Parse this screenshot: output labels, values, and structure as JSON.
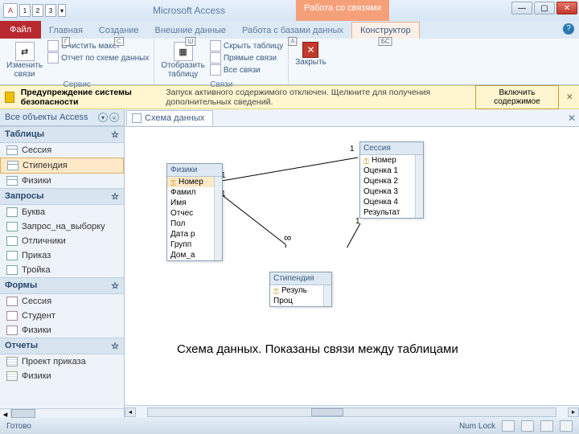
{
  "title": "Microsoft Access",
  "context_tab": "Работа со связями",
  "tabs": {
    "file": "Файл",
    "list": [
      {
        "label": "Главная",
        "key": "Г"
      },
      {
        "label": "Создание",
        "key": "С"
      },
      {
        "label": "Внешние данные",
        "key": "Ш"
      },
      {
        "label": "Работа с базами данных",
        "key": "А"
      },
      {
        "label": "Конструктор",
        "key": "БС"
      }
    ]
  },
  "ribbon": {
    "edit_rel_l1": "Изменить",
    "edit_rel_l2": "связи",
    "clear_layout": "Очистить макет",
    "rel_report": "Отчет по схеме данных",
    "g1": "Сервис",
    "show_tbl_l1": "Отобразить",
    "show_tbl_l2": "таблицу",
    "hide_tbl": "Скрыть таблицу",
    "direct": "Прямые связи",
    "all": "Все связи",
    "g2": "Связи",
    "close": "Закрыть"
  },
  "security": {
    "title": "Предупреждение системы безопасности",
    "msg": "Запуск активного содержимого отключен. Щелкните для получения дополнительных сведений.",
    "btn": "Включить содержимое"
  },
  "nav": {
    "header": "Все объекты Access",
    "sections": {
      "tables": "Таблицы",
      "queries": "Запросы",
      "forms": "Формы",
      "reports": "Отчеты"
    },
    "tables": [
      "Сессия",
      "Стипендия",
      "Физики"
    ],
    "queries": [
      "Буква",
      "Запрос_на_выборку",
      "Отличники",
      "Приказ",
      "Тройка"
    ],
    "forms": [
      "Сессия",
      "Студент",
      "Физики"
    ],
    "reports": [
      "Проект приказа",
      "Физики"
    ]
  },
  "doc_tab": "Схема данных",
  "tables_canvas": {
    "fiziki": {
      "title": "Физики",
      "fields": [
        "Номер",
        "Фамил",
        "Имя",
        "Отчес",
        "Пол",
        "Дата р",
        "Групп",
        "Дом_а"
      ]
    },
    "sessia": {
      "title": "Сессия",
      "fields": [
        "Номер",
        "Оценка 1",
        "Оценка 2",
        "Оценка 3",
        "Оценка 4",
        "Результат"
      ]
    },
    "stipendia": {
      "title": "Стипендия",
      "fields": [
        "Резуль",
        "Проц"
      ]
    }
  },
  "rel_labels": {
    "one": "1",
    "many": "∞"
  },
  "caption": "Схема данных. Показаны связи между таблицами",
  "status": {
    "ready": "Готово",
    "numlock": "Num Lock"
  }
}
